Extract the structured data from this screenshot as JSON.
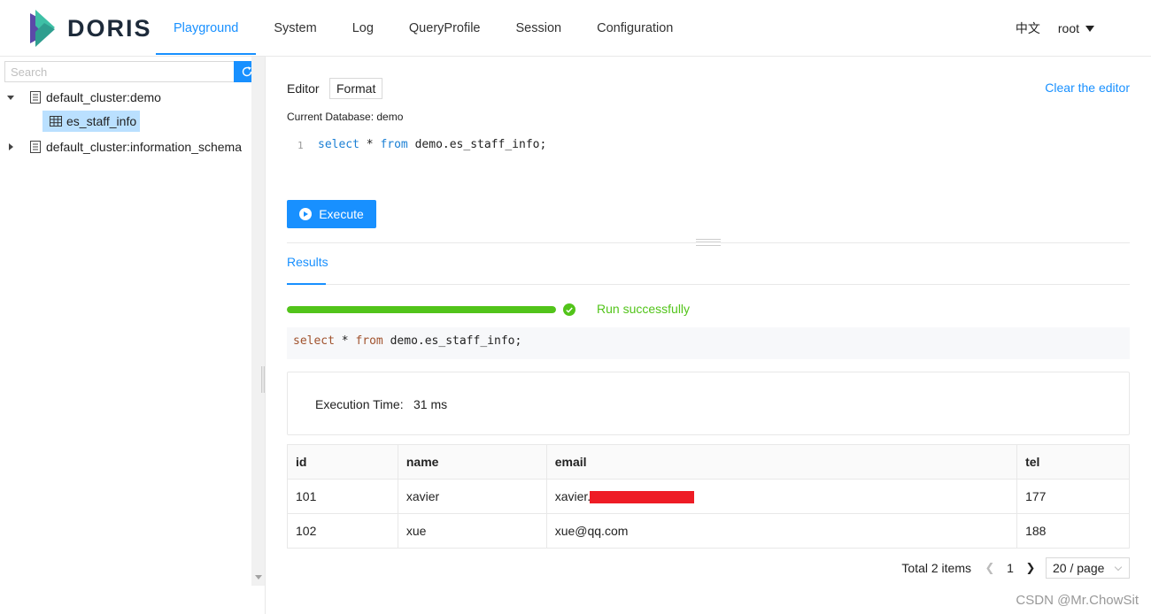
{
  "app": {
    "logo_text": "DORIS",
    "brand_colors": {
      "primary": "#1890ff",
      "success": "#52c41a",
      "logo_purple": "#5b4aa8",
      "logo_teal": "#3ec0a6"
    }
  },
  "nav": {
    "items": [
      {
        "label": "Playground",
        "active": true
      },
      {
        "label": "System",
        "active": false
      },
      {
        "label": "Log",
        "active": false
      },
      {
        "label": "QueryProfile",
        "active": false
      },
      {
        "label": "Session",
        "active": false
      },
      {
        "label": "Configuration",
        "active": false
      }
    ],
    "language": "中文",
    "user": "root"
  },
  "sidebar": {
    "search_placeholder": "Search",
    "tree": [
      {
        "label": "default_cluster:demo",
        "expanded": true,
        "children": [
          {
            "label": "es_staff_info",
            "selected": true
          }
        ]
      },
      {
        "label": "default_cluster:information_schema",
        "expanded": false
      }
    ]
  },
  "editor": {
    "label": "Editor",
    "format_label": "Format",
    "clear_label": "Clear the editor",
    "current_db_label": "Current Database: demo",
    "line_number": "1",
    "code": {
      "kw1": "select",
      "star": " * ",
      "kw2": "from",
      "rest": " demo.es_staff_info;"
    },
    "execute_label": "Execute"
  },
  "results": {
    "tab_label": "Results",
    "progress": 100,
    "status_text": "Run successfully",
    "sql": {
      "kw1": "select",
      "star": " * ",
      "kw2": "from",
      "rest": " demo.es_staff_info;"
    },
    "execution_time_label": "Execution Time:",
    "execution_time_value": "31 ms",
    "columns": [
      "id",
      "name",
      "email",
      "tel"
    ],
    "rows": [
      [
        "101",
        "xavier",
        "xavier.",
        "177"
      ],
      [
        "102",
        "xue",
        "xue@qq.com",
        "188"
      ]
    ]
  },
  "pagination": {
    "total": "Total 2 items",
    "current_page": "1",
    "page_size": "20 / page"
  },
  "watermark": "CSDN @Mr.ChowSit"
}
